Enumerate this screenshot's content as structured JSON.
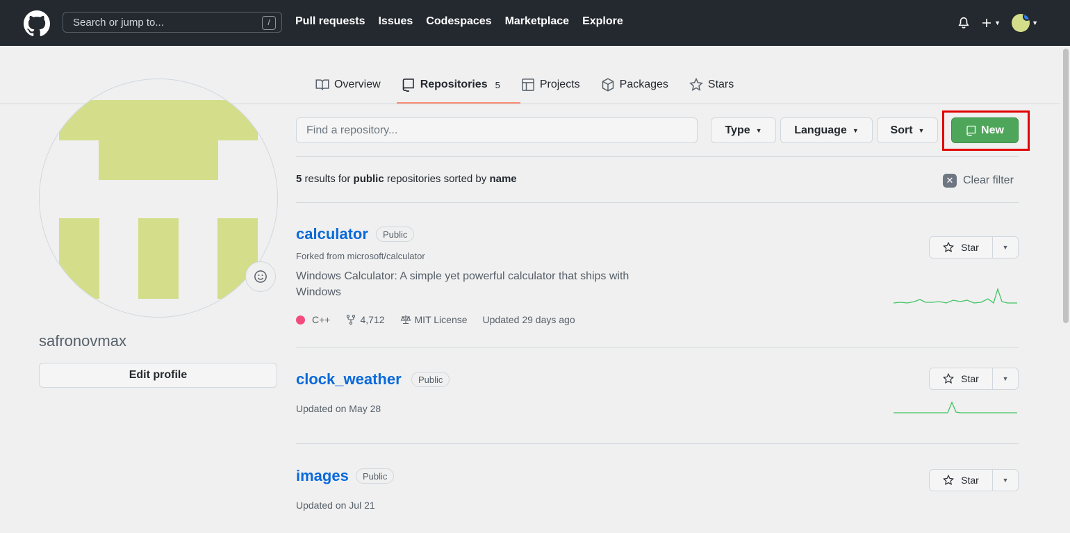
{
  "header": {
    "search_placeholder": "Search or jump to...",
    "search_shortcut": "/",
    "nav": [
      "Pull requests",
      "Issues",
      "Codespaces",
      "Marketplace",
      "Explore"
    ],
    "icons": [
      "bell-icon",
      "plus-icon",
      "avatar"
    ]
  },
  "tabs": [
    {
      "label": "Overview",
      "icon": "book-icon"
    },
    {
      "label": "Repositories",
      "icon": "repo-icon",
      "count": "5",
      "active": true
    },
    {
      "label": "Projects",
      "icon": "table-icon"
    },
    {
      "label": "Packages",
      "icon": "package-icon"
    },
    {
      "label": "Stars",
      "icon": "star-icon"
    }
  ],
  "profile": {
    "username": "safronovmax",
    "edit_label": "Edit profile"
  },
  "filters": {
    "find_placeholder": "Find a repository...",
    "type_label": "Type",
    "language_label": "Language",
    "sort_label": "Sort",
    "new_label": "New"
  },
  "results": {
    "count": "5",
    "t1": " results for ",
    "scope": "public",
    "t2": " repositories sorted by ",
    "sort": "name",
    "clear_label": "Clear filter"
  },
  "repos": [
    {
      "name": "calculator",
      "visibility": "Public",
      "forked_from": "Forked from microsoft/calculator",
      "description": "Windows Calculator: A simple yet powerful calculator that ships with Windows",
      "language": "C++",
      "language_color": "#f34b7d",
      "forks": "4,712",
      "license": "MIT License",
      "updated": "Updated 29 days ago",
      "star_label": "Star"
    },
    {
      "name": "clock_weather",
      "visibility": "Public",
      "updated": "Updated on May 28",
      "star_label": "Star"
    },
    {
      "name": "images",
      "visibility": "Public",
      "updated": "Updated on Jul 21",
      "star_label": "Star"
    }
  ],
  "colors": {
    "header_bg": "#24292f",
    "new_button": "#4ea65a",
    "link": "#0969da",
    "highlight": "#e00000",
    "tab_underline": "#fd8c73"
  }
}
